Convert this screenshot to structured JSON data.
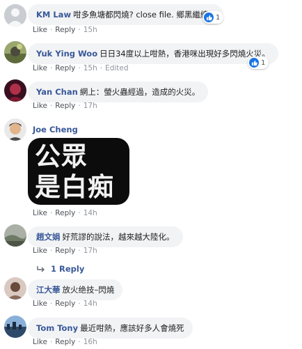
{
  "actions": {
    "like": "Like",
    "reply": "Reply",
    "sep": "·"
  },
  "comments": [
    {
      "author": "KM Law",
      "text": "咁多魚塘都閃燒? close file. 鄉黑繼續",
      "time": "15h",
      "reactions": "1",
      "edited": ""
    },
    {
      "author": "Yuk Ying Woo",
      "text": "日日34度以上咁熱，香港咪出現好多閃燒火災。",
      "time": "15h",
      "reactions": "1",
      "edited": "Edited"
    },
    {
      "author": "Yan Chan",
      "text": "網上：螢火蟲經過，造成的火災。",
      "time": "17h"
    },
    {
      "author": "Joe Cheng",
      "text": "",
      "time": "14h",
      "image_text": [
        "公眾",
        "是白痴"
      ]
    },
    {
      "author": "趙文娟",
      "text": "好荒謬的說法，越來越大陸化。",
      "time": "17h"
    },
    {
      "author": "江大華",
      "text": "放火绝技–閃燒",
      "time": "14h"
    },
    {
      "author": "Tom Tony",
      "text": "最近咁熱，應該好多人會燒死",
      "time": "16h"
    }
  ],
  "replies_link": {
    "label": "1 Reply"
  },
  "colors": {
    "link": "#385898",
    "bubble": "#f2f3f5",
    "meta": "#90949c",
    "like_blue": "#1b74e4"
  }
}
